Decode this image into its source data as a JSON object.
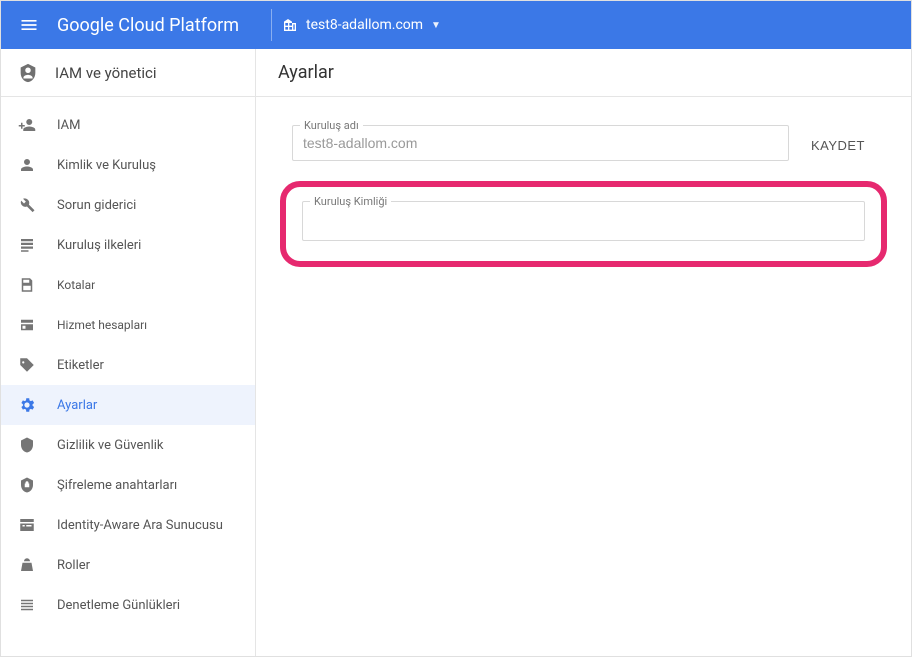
{
  "topbar": {
    "brand": "Google Cloud Platform",
    "project_name": "test8-adallom.com"
  },
  "section": {
    "title": "IAM ve yönetici"
  },
  "nav": {
    "items": [
      {
        "label": "IAM"
      },
      {
        "label": "Kimlik ve Kuruluş"
      },
      {
        "label": "Sorun giderici"
      },
      {
        "label": "Kuruluş ilkeleri"
      },
      {
        "label": "Kotalar"
      },
      {
        "label": "Hizmet hesapları"
      },
      {
        "label": "Etiketler"
      },
      {
        "label": "Ayarlar"
      },
      {
        "label": "Gizlilik ve Güvenlik"
      },
      {
        "label": "Şifreleme anahtarları"
      },
      {
        "label": "Identity-Aware Ara Sunucusu"
      },
      {
        "label": "Roller"
      },
      {
        "label": "Denetleme Günlükleri"
      }
    ]
  },
  "main": {
    "title": "Ayarlar",
    "org_name_label": "Kuruluş adı",
    "org_name_value": "test8-adallom.com",
    "save_label": "KAYDET",
    "org_id_label": "Kuruluş Kimliği",
    "org_id_value": ""
  },
  "colors": {
    "accent": "#3b78e7",
    "highlight": "#e6296f"
  }
}
